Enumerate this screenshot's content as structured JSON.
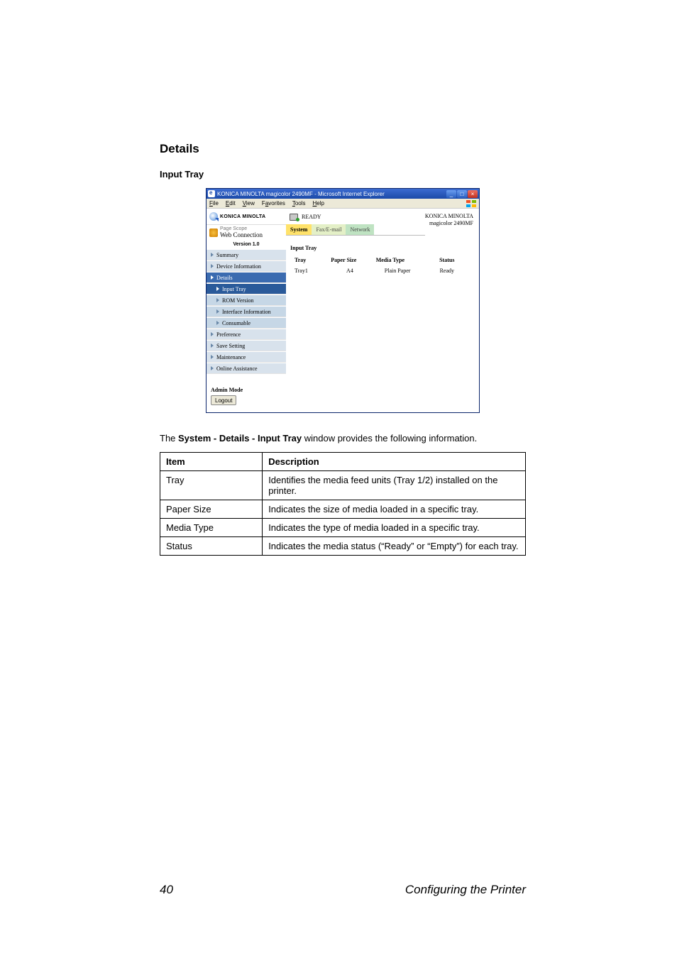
{
  "headings": {
    "details": "Details",
    "input_tray": "Input Tray"
  },
  "browser": {
    "title": "KONICA MINOLTA magicolor 2490MF - Microsoft Internet Explorer",
    "menu": {
      "file": "File",
      "edit": "Edit",
      "view": "View",
      "favorites": "Favorites",
      "tools": "Tools",
      "help": "Help"
    },
    "win": {
      "min": "_",
      "max": "□",
      "close": "×"
    }
  },
  "brand": {
    "name": "KONICA MINOLTA",
    "ps": "Page Scope",
    "wc": "Web Connection",
    "version": "Version 1.0"
  },
  "nav": {
    "summary": "Summary",
    "device_info": "Device Information",
    "details": "Details",
    "input_tray": "Input Tray",
    "rom": "ROM Version",
    "iface": "Interface Information",
    "consumable": "Consumable",
    "preference": "Preference",
    "save": "Save Setting",
    "maintenance": "Maintenance",
    "online": "Online Assistance"
  },
  "admin": {
    "label": "Admin Mode",
    "logout": "Logout"
  },
  "main": {
    "ready": "READY",
    "tabs": {
      "system": "System",
      "fax": "Fax/E-mail",
      "network": "Network"
    },
    "model_line1": "KONICA MINOLTA",
    "model_line2": "magicolor 2490MF",
    "section_title": "Input Tray",
    "table": {
      "headers": {
        "tray": "Tray",
        "paper_size": "Paper Size",
        "media_type": "Media Type",
        "status": "Status"
      },
      "row": {
        "tray": "Tray1",
        "paper_size": "A4",
        "media_type": "Plain Paper",
        "status": "Ready"
      }
    }
  },
  "description": {
    "before": "The ",
    "bold": "System - Details - Input Tray",
    "after": " window provides the following information."
  },
  "info_table": {
    "header": {
      "item": "Item",
      "description": "Description"
    },
    "rows": [
      {
        "item": "Tray",
        "description": "Identifies the media feed units (Tray 1/2) installed on the printer."
      },
      {
        "item": "Paper Size",
        "description": "Indicates the size of media loaded in a specific tray."
      },
      {
        "item": "Media Type",
        "description": "Indicates the type of media loaded in a specific tray."
      },
      {
        "item": "Status",
        "description": "Indicates the media status (“Ready” or “Empty”) for each tray."
      }
    ]
  },
  "footer": {
    "page": "40",
    "title": "Configuring the Printer"
  }
}
